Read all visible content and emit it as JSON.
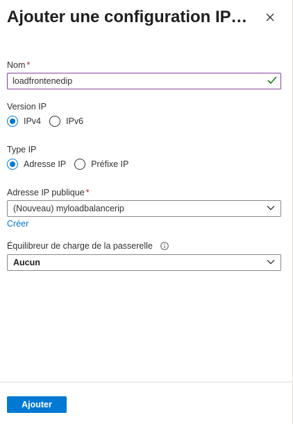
{
  "panel": {
    "title": "Ajouter une configuration IP f..."
  },
  "name_field": {
    "label": "Nom",
    "required_mark": "*",
    "value": "loadfrontenedip",
    "valid_icon": "check-icon"
  },
  "ip_version": {
    "label": "Version IP",
    "options": [
      {
        "label": "IPv4",
        "checked": true
      },
      {
        "label": "IPv6",
        "checked": false
      }
    ]
  },
  "ip_type": {
    "label": "Type IP",
    "options": [
      {
        "label": "Adresse IP",
        "checked": true
      },
      {
        "label": "Préfixe IP",
        "checked": false
      }
    ]
  },
  "public_ip": {
    "label": "Adresse IP publique",
    "required_mark": "*",
    "selected": "(Nouveau) myloadbalancerip",
    "create_link": "Créer"
  },
  "gateway_lb": {
    "label": "Équilibreur de charge de la passerelle",
    "info_icon": "info-icon",
    "selected": "Aucun"
  },
  "footer": {
    "submit_label": "Ajouter"
  },
  "colors": {
    "accent": "#0078d4",
    "required": "#a4262c",
    "valid": "#107c10",
    "focus_border": "#8a3ea8"
  }
}
